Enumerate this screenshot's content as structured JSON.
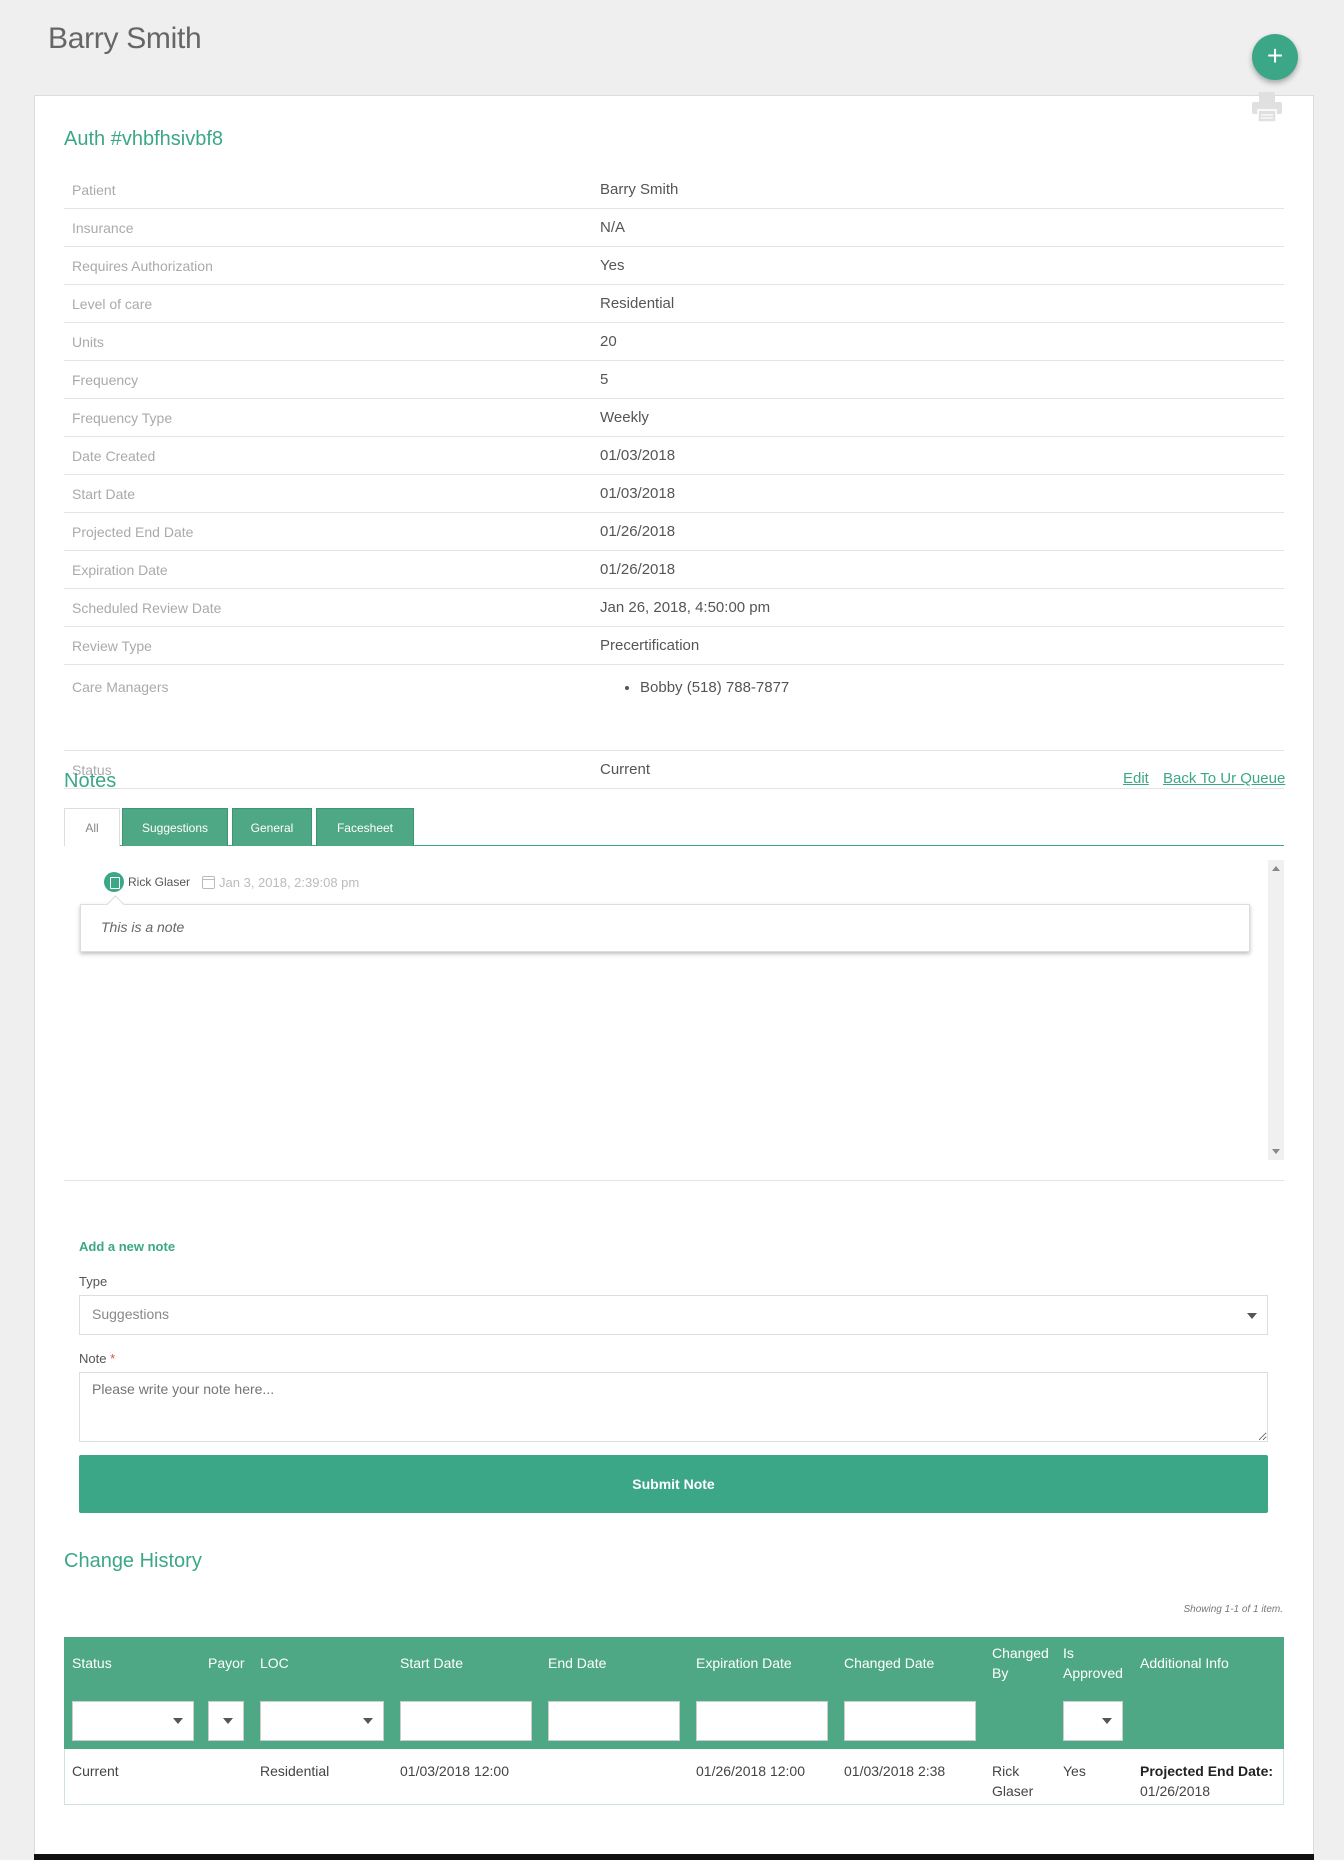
{
  "header": {
    "title": "Barry Smith",
    "add_label": "+"
  },
  "auth": {
    "title": "Auth #vhbfhsivbf8",
    "rows": [
      {
        "label": "Patient",
        "value": "Barry Smith"
      },
      {
        "label": "Insurance",
        "value": "N/A"
      },
      {
        "label": "Requires Authorization",
        "value": "Yes"
      },
      {
        "label": "Level of care",
        "value": "Residential"
      },
      {
        "label": "Units",
        "value": "20"
      },
      {
        "label": "Frequency",
        "value": "5"
      },
      {
        "label": "Frequency Type",
        "value": "Weekly"
      },
      {
        "label": "Date Created",
        "value": "01/03/2018"
      },
      {
        "label": "Start Date",
        "value": "01/03/2018"
      },
      {
        "label": "Projected End Date",
        "value": "01/26/2018"
      },
      {
        "label": "Expiration Date",
        "value": "01/26/2018"
      },
      {
        "label": "Scheduled Review Date",
        "value": "Jan 26, 2018, 4:50:00 pm"
      },
      {
        "label": "Review Type",
        "value": "Precertification"
      }
    ],
    "care_managers_label": "Care Managers",
    "care_managers": [
      "Bobby (518) 788-7877"
    ],
    "status_label": "Status",
    "status_value": "Current"
  },
  "notes": {
    "title": "Notes",
    "edit_link": "Edit",
    "back_link": "Back To Ur Queue",
    "tabs": [
      "All",
      "Suggestions",
      "General",
      "Facesheet"
    ],
    "entries": [
      {
        "author": "Rick Glaser",
        "date": "Jan 3, 2018, 2:39:08 pm",
        "text": "This is a note"
      }
    ]
  },
  "add_note": {
    "title": "Add a new note",
    "type_label": "Type",
    "type_value": "Suggestions",
    "note_label": "Note",
    "required_mark": "*",
    "note_placeholder": "Please write your note here...",
    "submit_label": "Submit Note"
  },
  "history": {
    "title": "Change History",
    "summary": "Showing 1-1 of 1 item.",
    "columns": [
      "Status",
      "Payor",
      "LOC",
      "Start Date",
      "End Date",
      "Expiration Date",
      "Changed Date",
      "Changed By",
      "Is Approved",
      "Additional Info"
    ],
    "rows": [
      {
        "status": "Current",
        "payor": "",
        "loc": "Residential",
        "start_date": "01/03/2018 12:00",
        "end_date": "",
        "expiration_date": "01/26/2018 12:00",
        "changed_date": "01/03/2018 2:38",
        "changed_by": "Rick Glaser",
        "is_approved": "Yes",
        "additional_info_label": "Projected End Date:",
        "additional_info_value": "01/26/2018"
      }
    ]
  },
  "colors": {
    "accent": "#3ca787",
    "table_header": "#4fa885",
    "background": "#efefef"
  },
  "icons": [
    "plus-icon",
    "printer-icon",
    "note-icon",
    "calendar-icon",
    "chevron-down-icon"
  ]
}
